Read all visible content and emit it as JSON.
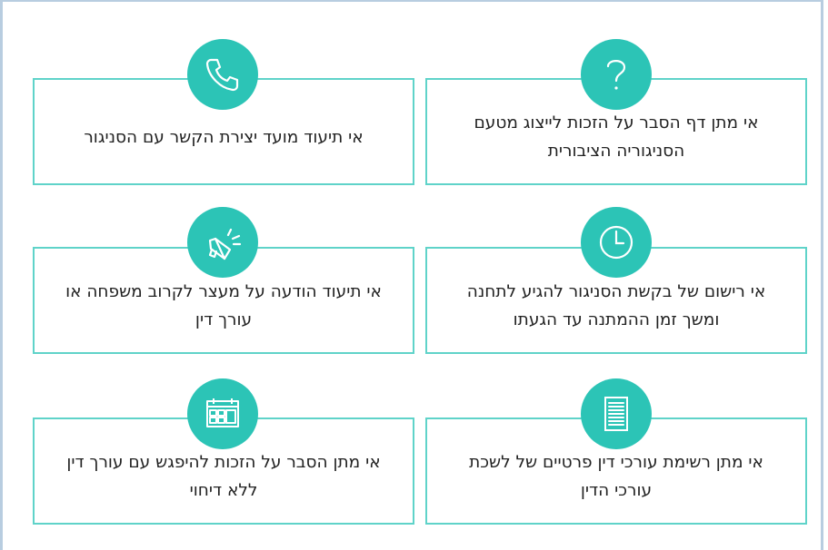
{
  "accent_color": "#2cc4b6",
  "border_color": "#5fd3c9",
  "items": [
    {
      "text": "אי מתן דף הסבר על הזכות לייצוג מטעם הסניגוריה הציבורית",
      "icon": "question-mark-icon"
    },
    {
      "text": "אי תיעוד מועד יצירת הקשר עם הסניגור",
      "icon": "phone-icon"
    },
    {
      "text": "אי רישום של בקשת הסניגור להגיע לתחנה ומשך זמן ההמתנה עד הגעתו",
      "icon": "clock-icon"
    },
    {
      "text": "אי תיעוד הודעה על מעצר לקרוב משפחה או עורך דין",
      "icon": "megaphone-icon"
    },
    {
      "text": "אי מתן רשימת עורכי דין פרטיים של לשכת עורכי הדין",
      "icon": "document-list-icon"
    },
    {
      "text": "אי מתן הסבר על הזכות להיפגש עם עורך דין ללא דיחוי",
      "icon": "calendar-icon"
    }
  ]
}
